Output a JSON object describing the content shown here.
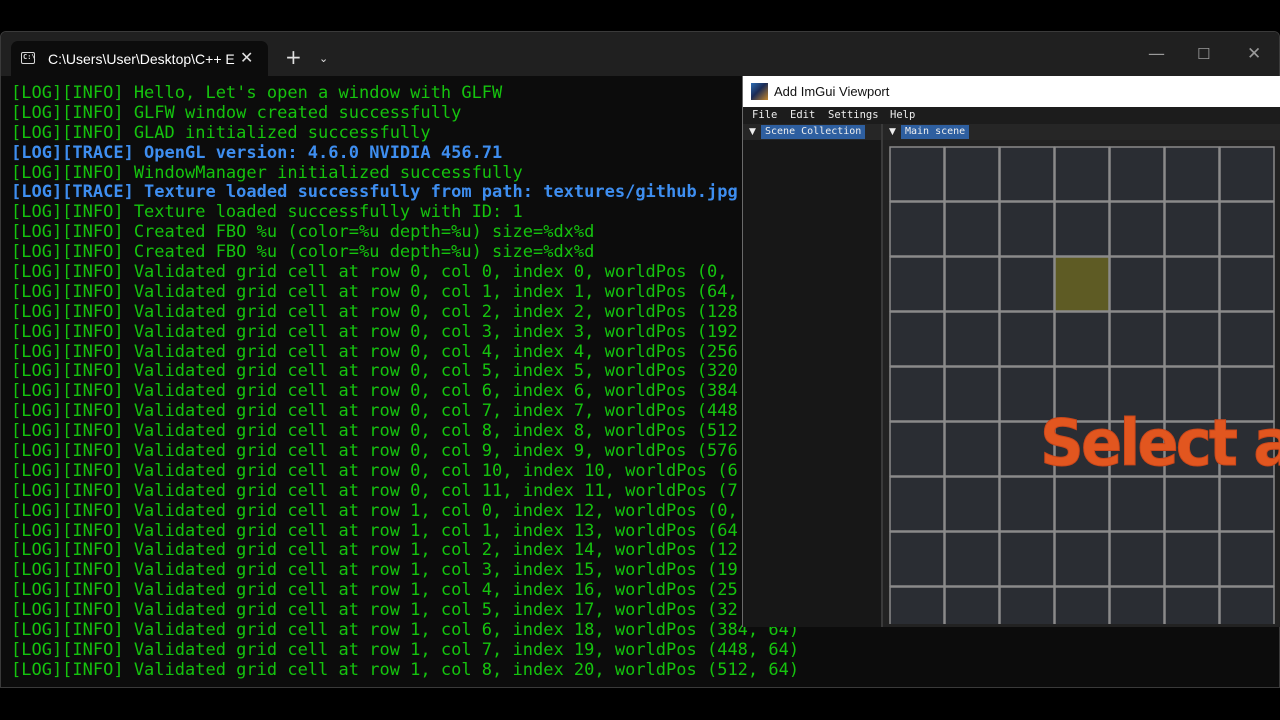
{
  "terminal": {
    "tab_title": "C:\\Users\\User\\Desktop\\C++ E",
    "tab_icon_glyph": "C:\\",
    "close_glyph": "✕",
    "new_tab_glyph": "+",
    "dropdown_glyph": "⌄",
    "window_controls": {
      "minimize": "—",
      "maximize": "☐",
      "close": "✕"
    },
    "log_lines": [
      {
        "level": "info",
        "text": "[LOG][INFO] Hello, Let's open a window with GLFW"
      },
      {
        "level": "info",
        "text": "[LOG][INFO] GLFW window created successfully"
      },
      {
        "level": "info",
        "text": "[LOG][INFO] GLAD initialized successfully"
      },
      {
        "level": "trace",
        "text": "[LOG][TRACE] OpenGL version: 4.6.0 NVIDIA 456.71"
      },
      {
        "level": "info",
        "text": "[LOG][INFO] WindowManager initialized successfully"
      },
      {
        "level": "trace",
        "text": "[LOG][TRACE] Texture loaded successfully from path: textures/github.jpg"
      },
      {
        "level": "info",
        "text": "[LOG][INFO] Texture loaded successfully with ID: 1"
      },
      {
        "level": "info",
        "text": "[LOG][INFO] Created FBO %u (color=%u depth=%u) size=%dx%d"
      },
      {
        "level": "info",
        "text": "[LOG][INFO] Created FBO %u (color=%u depth=%u) size=%dx%d"
      },
      {
        "level": "info",
        "text": "[LOG][INFO] Validated grid cell at row 0, col 0, index 0, worldPos (0,"
      },
      {
        "level": "info",
        "text": "[LOG][INFO] Validated grid cell at row 0, col 1, index 1, worldPos (64,"
      },
      {
        "level": "info",
        "text": "[LOG][INFO] Validated grid cell at row 0, col 2, index 2, worldPos (128"
      },
      {
        "level": "info",
        "text": "[LOG][INFO] Validated grid cell at row 0, col 3, index 3, worldPos (192"
      },
      {
        "level": "info",
        "text": "[LOG][INFO] Validated grid cell at row 0, col 4, index 4, worldPos (256"
      },
      {
        "level": "info",
        "text": "[LOG][INFO] Validated grid cell at row 0, col 5, index 5, worldPos (320"
      },
      {
        "level": "info",
        "text": "[LOG][INFO] Validated grid cell at row 0, col 6, index 6, worldPos (384"
      },
      {
        "level": "info",
        "text": "[LOG][INFO] Validated grid cell at row 0, col 7, index 7, worldPos (448"
      },
      {
        "level": "info",
        "text": "[LOG][INFO] Validated grid cell at row 0, col 8, index 8, worldPos (512"
      },
      {
        "level": "info",
        "text": "[LOG][INFO] Validated grid cell at row 0, col 9, index 9, worldPos (576"
      },
      {
        "level": "info",
        "text": "[LOG][INFO] Validated grid cell at row 0, col 10, index 10, worldPos (6"
      },
      {
        "level": "info",
        "text": "[LOG][INFO] Validated grid cell at row 0, col 11, index 11, worldPos (7"
      },
      {
        "level": "info",
        "text": "[LOG][INFO] Validated grid cell at row 1, col 0, index 12, worldPos (0,"
      },
      {
        "level": "info",
        "text": "[LOG][INFO] Validated grid cell at row 1, col 1, index 13, worldPos (64"
      },
      {
        "level": "info",
        "text": "[LOG][INFO] Validated grid cell at row 1, col 2, index 14, worldPos (12"
      },
      {
        "level": "info",
        "text": "[LOG][INFO] Validated grid cell at row 1, col 3, index 15, worldPos (19"
      },
      {
        "level": "info",
        "text": "[LOG][INFO] Validated grid cell at row 1, col 4, index 16, worldPos (25"
      },
      {
        "level": "info",
        "text": "[LOG][INFO] Validated grid cell at row 1, col 5, index 17, worldPos (32"
      },
      {
        "level": "info",
        "text": "[LOG][INFO] Validated grid cell at row 1, col 6, index 18, worldPos (384, 64)"
      },
      {
        "level": "info",
        "text": "[LOG][INFO] Validated grid cell at row 1, col 7, index 19, worldPos (448, 64)"
      },
      {
        "level": "info",
        "text": "[LOG][INFO] Validated grid cell at row 1, col 8, index 20, worldPos (512, 64)"
      }
    ]
  },
  "app": {
    "title": "Add ImGui Viewport",
    "menu": {
      "file": "File",
      "edit": "Edit",
      "settings": "Settings",
      "help": "Help"
    },
    "scene_collection": {
      "tab_label": "Scene Collection",
      "collapse_glyph": "▼"
    },
    "main_scene": {
      "tab_label": "Main scene",
      "collapse_glyph": "▼",
      "grid": {
        "rows": 9,
        "cols": 7,
        "highlighted_cell": {
          "row": 2,
          "col": 3
        }
      },
      "overlay_text": "Select a cell"
    }
  },
  "colors": {
    "log_info": "#15c30e",
    "log_trace": "#3e8ef0",
    "grid_cell": "#2a2d33",
    "grid_line": "#8a8a8a",
    "grid_highlight": "#5e5b24",
    "overlay_text": "#e2561f",
    "tab_active": "#2e5fa0"
  }
}
